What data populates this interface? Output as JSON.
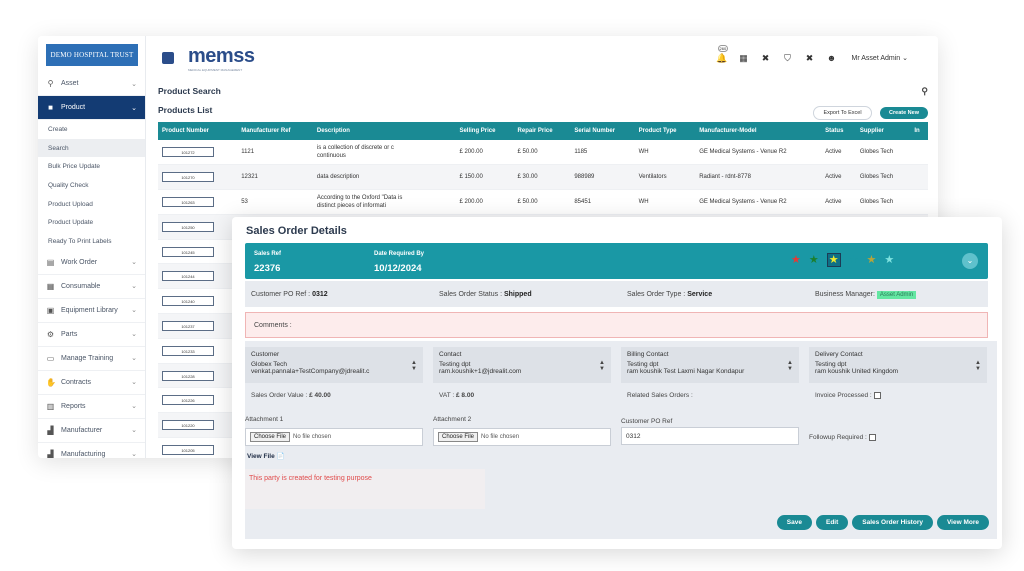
{
  "back": {
    "logo_text": "DEMO HOSPITAL TRUST",
    "brand": "memss",
    "brand_sub": "MEDICAL EQUIPMENT MANAGEMENT",
    "notification_count": "260",
    "admin_name": "Mr Asset Admin",
    "page_title": "Product Search",
    "list_title": "Products List",
    "export_label": "Export To Excel",
    "create_label": "Create New",
    "sidebar": {
      "asset": "Asset",
      "product": "Product",
      "sub_items": [
        "Create",
        "Search",
        "Bulk Price Update",
        "Quality Check",
        "Product Upload",
        "Product Update",
        "Ready To Print Labels"
      ],
      "groups": [
        "Work Order",
        "Consumable",
        "Equipment Library",
        "Parts",
        "Manage Training",
        "Contracts",
        "Reports",
        "Manufacturer",
        "Manufacturing"
      ]
    },
    "columns": [
      "Product Number",
      "Manufacturer Ref",
      "Description",
      "Selling Price",
      "Repair Price",
      "Serial Number",
      "Product Type",
      "Manufacturer-Model",
      "Status",
      "Supplier",
      "In"
    ],
    "rows": [
      {
        "pn": "101272",
        "mref": "1121",
        "desc": "is a collection of discrete or c continuous",
        "sell": "£ 200.00",
        "repair": "£ 50.00",
        "serial": "1185",
        "type": "WH",
        "model": "GE Medical Systems - Venue R2",
        "status": "Active",
        "supplier": "Globes Tech"
      },
      {
        "pn": "101270",
        "mref": "12321",
        "desc": "data description",
        "sell": "£ 150.00",
        "repair": "£ 30.00",
        "serial": "988989",
        "type": "Ventilators",
        "model": "Radiant - rdnt-8778",
        "status": "Active",
        "supplier": "Globes Tech"
      },
      {
        "pn": "101263",
        "mref": "53",
        "desc": "According to the Oxford \"Data is distinct pieces of informati",
        "sell": "£ 200.00",
        "repair": "£ 50.00",
        "serial": "85451",
        "type": "WH",
        "model": "GE Medical Systems - Venue R2",
        "status": "Active",
        "supplier": "Globes Tech"
      },
      {
        "pn": "101250"
      },
      {
        "pn": "101245"
      },
      {
        "pn": "101244"
      },
      {
        "pn": "101240"
      },
      {
        "pn": "101237"
      },
      {
        "pn": "101233"
      },
      {
        "pn": "101228"
      },
      {
        "pn": "101226"
      },
      {
        "pn": "101220"
      },
      {
        "pn": "101205"
      }
    ]
  },
  "so": {
    "title": "Sales Order Details",
    "sales_ref_label": "Sales Ref",
    "sales_ref": "22376",
    "date_label": "Date Required By",
    "date": "10/12/2024",
    "star_colors": [
      "#e53935",
      "#1b7f2e",
      "#f2ea2d",
      "#1a98a5",
      "#b8a43a",
      "#7fe3e0"
    ],
    "customer_po_label": "Customer PO Ref :",
    "customer_po": "0312",
    "status_label": "Sales Order Status :",
    "status": "Shipped",
    "type_label": "Sales Order Type :",
    "type": "Service",
    "manager_label": "Business Manager:",
    "manager": "Asset Admin",
    "comments_label": "Comments :",
    "customer": {
      "title": "Customer",
      "name": "Globex Tech",
      "detail": "venkat.pannala+TestCompany@jdrealit.c"
    },
    "contact": {
      "title": "Contact",
      "name": "Testing dpt",
      "detail": "ram.koushik+1@jdrealit.com"
    },
    "billing": {
      "title": "Billing Contact",
      "name": "Testing dpt",
      "detail": "ram koushik Test Laxmi Nagar Kondapur"
    },
    "delivery": {
      "title": "Delivery Contact",
      "name": "Testing dpt",
      "detail": "ram koushik United Kingdom"
    },
    "value_label": "Sales Order Value :",
    "value": "£ 40.00",
    "vat_label": "VAT :",
    "vat": "£ 8.00",
    "related_label": "Related Sales Orders :",
    "invoice_label": "Invoice Processed :",
    "attach1_label": "Attachment 1",
    "attach2_label": "Attachment 2",
    "choose_label": "Choose File",
    "no_file": "No file chosen",
    "po_ref_label": "Customer PO Ref",
    "po_ref_value": "0312",
    "followup_label": "Followup Required :",
    "view_file": "View File",
    "note": "This party is created for testing purpose",
    "buttons": {
      "save": "Save",
      "edit": "Edit",
      "history": "Sales Order History",
      "more": "View More"
    }
  }
}
